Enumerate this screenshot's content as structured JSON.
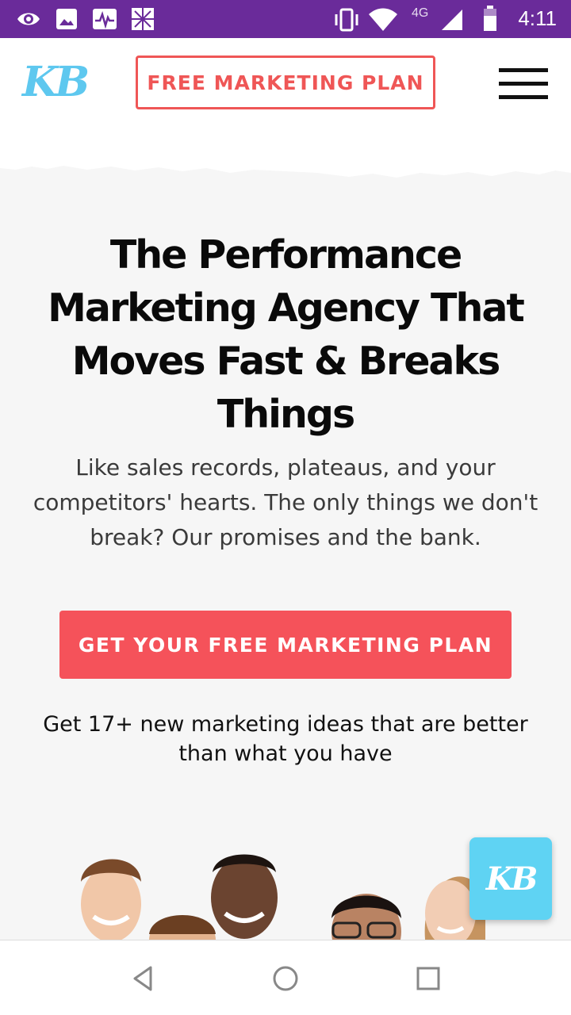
{
  "status_bar": {
    "time": "4:11",
    "network": "4G",
    "icons": [
      "eye-icon",
      "image-icon",
      "activity-icon",
      "puzzle-icon",
      "vibrate-icon",
      "wifi-icon",
      "signal-icon",
      "battery-icon"
    ]
  },
  "header": {
    "logo_text": "KB",
    "cta_label": "FREE MARKETING PLAN",
    "menu_icon": "hamburger-menu-icon"
  },
  "hero": {
    "title": "The Performance Marketing Agency That Moves Fast & Breaks Things",
    "subtitle": "Like sales records, plateaus, and your competitors' hearts. The only things we don't break? Our promises and the bank.",
    "cta_label": "GET YOUR FREE MARKETING PLAN",
    "cta_note": "Get 17+ new marketing ideas that are better than what you have"
  },
  "chat_widget": {
    "label": "KB"
  },
  "nav_bar": {
    "icons": [
      "back-icon",
      "home-icon",
      "recents-icon"
    ]
  },
  "colors": {
    "status_bar": "#6a2b9a",
    "accent_red": "#f5525a",
    "logo_blue": "#5ec8ef",
    "chat_blue": "#5fd3f3"
  }
}
